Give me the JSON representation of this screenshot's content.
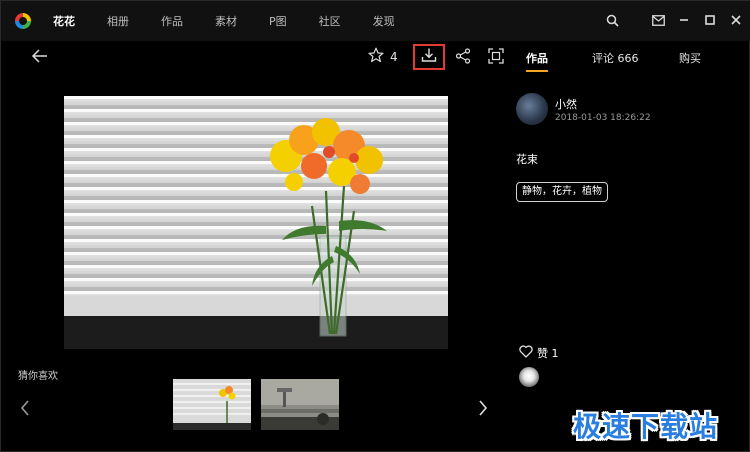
{
  "nav": {
    "items": [
      {
        "label": "花花",
        "active": true
      },
      {
        "label": "相册",
        "active": false
      },
      {
        "label": "作品",
        "active": false
      },
      {
        "label": "素材",
        "active": false
      },
      {
        "label": "P图",
        "active": false
      },
      {
        "label": "社区",
        "active": false
      },
      {
        "label": "发现",
        "active": false
      }
    ]
  },
  "toolbar": {
    "star_count": "4"
  },
  "tabs": {
    "works": "作品",
    "comments": "评论 666",
    "buy": "购买"
  },
  "author": {
    "name": "小然",
    "timestamp": "2018-01-03 18:26:22"
  },
  "post": {
    "title": "花束",
    "tag": "静物，花卉，植物"
  },
  "likes": {
    "label": "赞 1"
  },
  "recommend": {
    "title": "猜你喜欢"
  },
  "watermark": {
    "text": "极速下载站"
  },
  "colors": {
    "accent_underline": "#f5a623",
    "download_highlight": "#e53935",
    "watermark": "#2a7ee0"
  },
  "icons": [
    "app-logo-icon",
    "search-icon",
    "mail-icon",
    "minimize-icon",
    "maximize-icon",
    "close-icon",
    "back-arrow-icon",
    "star-icon",
    "download-icon",
    "share-icon",
    "fullscreen-icon",
    "heart-icon",
    "chevron-left-icon",
    "chevron-right-icon"
  ]
}
